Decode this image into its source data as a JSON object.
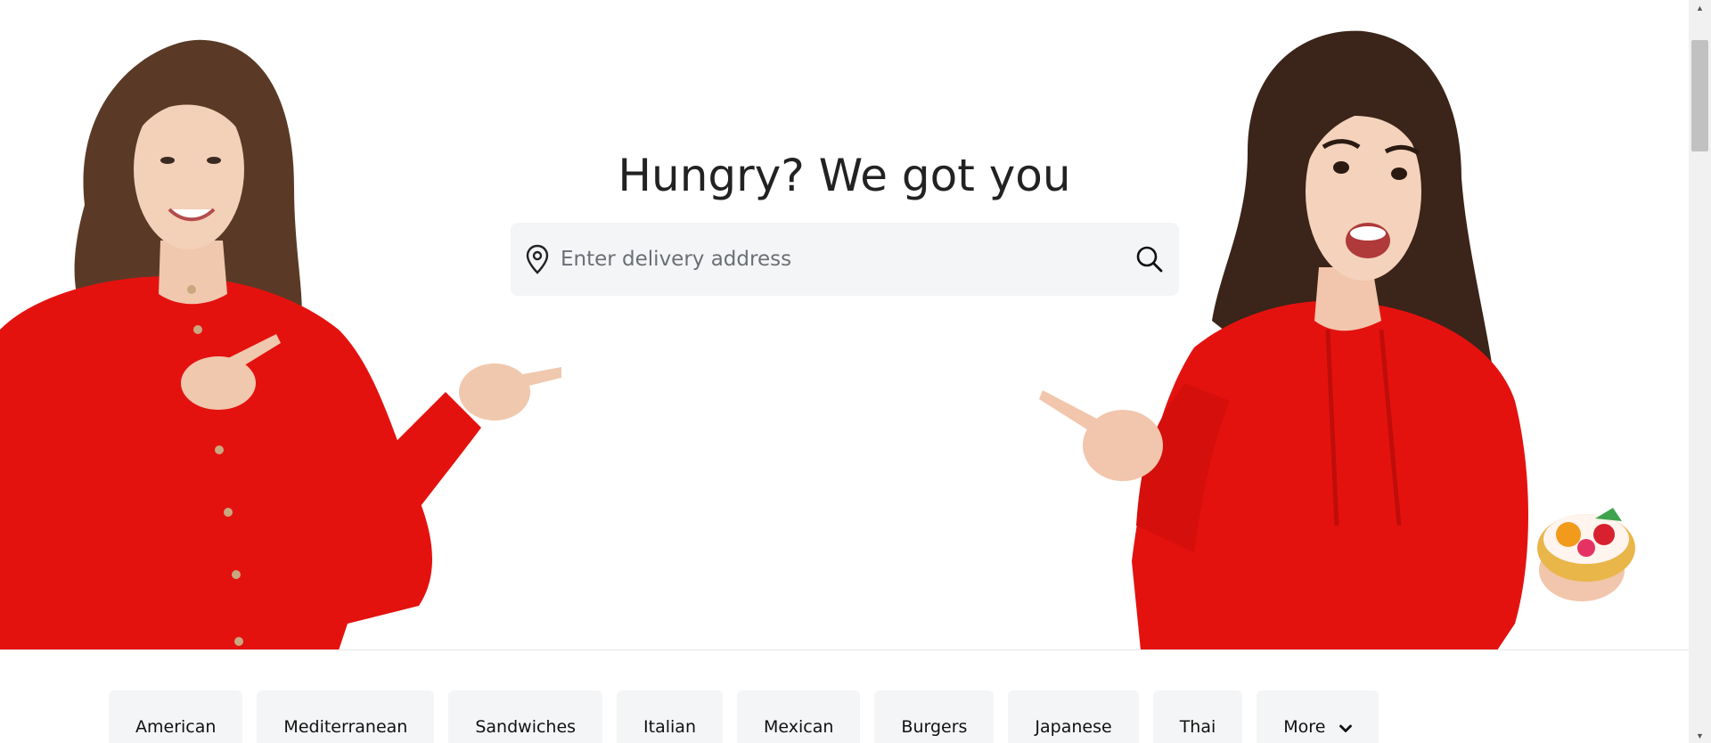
{
  "hero": {
    "headline": "Hungry? We got you"
  },
  "search": {
    "placeholder": "Enter delivery address",
    "value": ""
  },
  "categories": [
    {
      "label": "American"
    },
    {
      "label": "Mediterranean"
    },
    {
      "label": "Sandwiches"
    },
    {
      "label": "Italian"
    },
    {
      "label": "Mexican"
    },
    {
      "label": "Burgers"
    },
    {
      "label": "Japanese"
    },
    {
      "label": "Thai"
    },
    {
      "label": "More"
    }
  ],
  "icons": {
    "pin": "location-pin-icon",
    "search": "search-icon",
    "more": "chevron-down-icon"
  },
  "colors": {
    "accent_red": "#e4120f",
    "search_bg": "#f4f5f6",
    "text": "#222222"
  }
}
